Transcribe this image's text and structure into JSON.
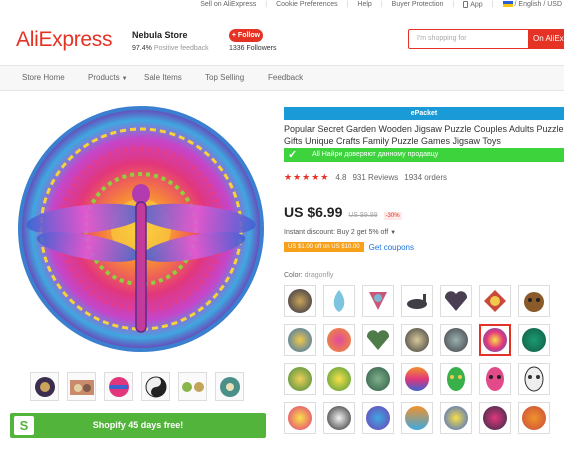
{
  "topbar": {
    "sell": "Sell on AliExpress",
    "cookie": "Cookie Preferences",
    "help": "Help",
    "buyer_protection": "Buyer Protection",
    "app": "App",
    "locale": "/ English / USD"
  },
  "header": {
    "logo": "AliExpress",
    "store_name": "Nebula Store",
    "feedback_value": "97.4%",
    "feedback_label": "Positive feedback",
    "follow_label": "+ Follow",
    "followers_value": "1336",
    "followers_label": "Followers",
    "search_placeholder": "I'm shopping for",
    "search_button": "On AliExpress"
  },
  "nav": {
    "items": [
      "Store Home",
      "Products",
      "Sale Items",
      "Top Selling",
      "Feedback"
    ]
  },
  "gallery": {
    "thumb_count": 6
  },
  "shopify": {
    "label": "Shopify 45 days free!",
    "icon": "S"
  },
  "product": {
    "badge": "ePacket",
    "title": "Popular Secret Garden Wooden Jigsaw Puzzle Couples Adults Puzzle Gifts Unique Crafts Family Puzzle Games Jigsaw Toys",
    "trust_text": "All Найри доверяют данному продавцу",
    "rating": "4.8",
    "rating_stars": "★★★★★",
    "reviews": "931 Reviews",
    "orders": "1934 orders",
    "price": "US $6.99",
    "old_price": "US $9.99",
    "discount": "-30%",
    "instant_discount": "Instant discount: Buy 2 get 5% off",
    "coupon": "US $1.00 off on US $10.00",
    "get_coupons": "Get coupons",
    "color_label": "Color:",
    "color_value": "dragonfly"
  },
  "colors": {
    "accent": "#e43225",
    "epacket": "#1a9bd7",
    "trust": "#3cd33c",
    "shopify": "#53b43b"
  }
}
